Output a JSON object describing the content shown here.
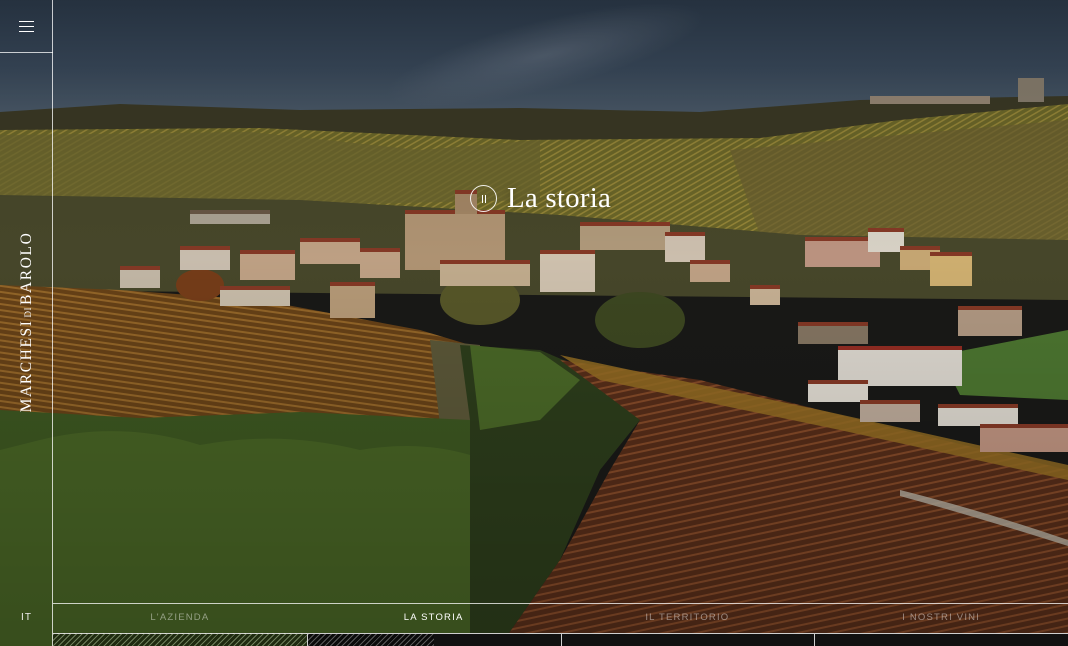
{
  "brand": {
    "logo_part1": "MARCHESI",
    "logo_part2": "DI",
    "logo_part3": "BAROLO"
  },
  "menu": {
    "icon": "hamburger-menu-icon"
  },
  "language": {
    "current": "IT"
  },
  "hero": {
    "title": "La storia",
    "control_icon": "pause-icon"
  },
  "nav": {
    "items": [
      {
        "label": "L'AZIENDA",
        "state": "visited"
      },
      {
        "label": "LA STORIA",
        "state": "active"
      },
      {
        "label": "IL TERRITORIO",
        "state": "upcoming"
      },
      {
        "label": "I NOSTRI VINI",
        "state": "upcoming"
      }
    ],
    "active_progress": 0.5
  },
  "colors": {
    "roof": "#8a3b27",
    "wall": "#c7a88a",
    "vine_autumn": "#7a4a1c",
    "grass": "#4f6b2a",
    "sky": "#3a4a5c"
  }
}
